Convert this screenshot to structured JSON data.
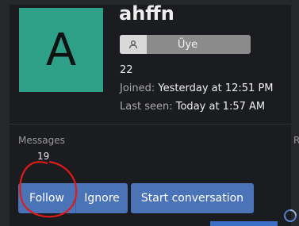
{
  "profile": {
    "avatar_letter": "A",
    "avatar_color": "#2fa088",
    "username": "ahffn",
    "role": "Üye",
    "age": "22",
    "joined_label": "Joined:",
    "joined_value": "Yesterday at 12:51 PM",
    "lastseen_label": "Last seen:",
    "lastseen_value": "Today at 1:57 AM"
  },
  "stats": {
    "messages_label": "Messages",
    "messages_value": "19",
    "clipped_label": "R"
  },
  "actions": {
    "follow_label": "Follow",
    "ignore_label": "Ignore",
    "start_conversation_label": "Start conversation"
  },
  "colors": {
    "button_blue": "#4a73b8",
    "annotation_red": "#e01919"
  }
}
